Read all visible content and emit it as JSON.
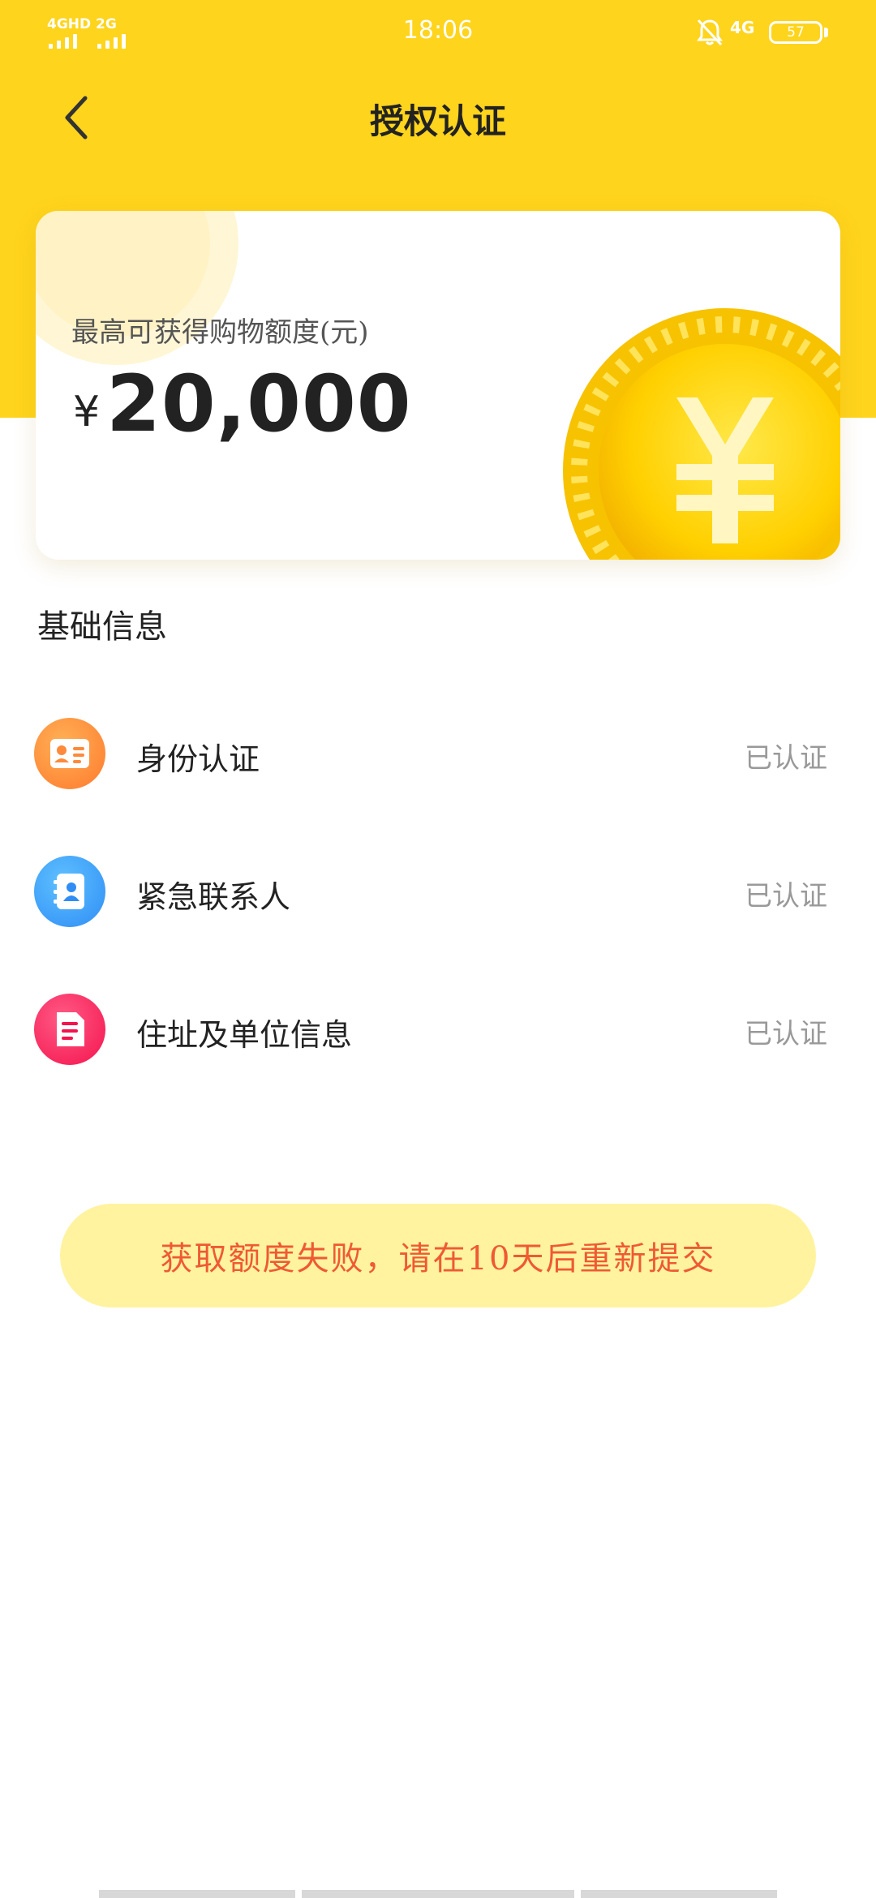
{
  "status_bar": {
    "signal1_label": "4GHD",
    "signal2_label": "2G",
    "time": "18:06",
    "network_label": "4G",
    "battery_level": "57"
  },
  "header": {
    "title": "授权认证",
    "back_icon": "chevron-left-icon"
  },
  "quota_card": {
    "label": "最高可获得购物额度(元)",
    "currency": "¥",
    "amount": "20,000"
  },
  "section": {
    "title": "基础信息",
    "items": [
      {
        "label": "身份认证",
        "status": "已认证",
        "icon": "id-card-icon",
        "color": "#ff8a3a"
      },
      {
        "label": "紧急联系人",
        "status": "已认证",
        "icon": "contact-book-icon",
        "color": "#3a9dff"
      },
      {
        "label": "住址及单位信息",
        "status": "已认证",
        "icon": "document-icon",
        "color": "#ff2d5e"
      }
    ]
  },
  "notice": {
    "text": "获取额度失败，请在10天后重新提交"
  },
  "colors": {
    "brand_yellow": "#ffd41c",
    "notice_bg": "#fff3a0",
    "notice_text": "#ef5a33",
    "status_gray": "#999999"
  }
}
